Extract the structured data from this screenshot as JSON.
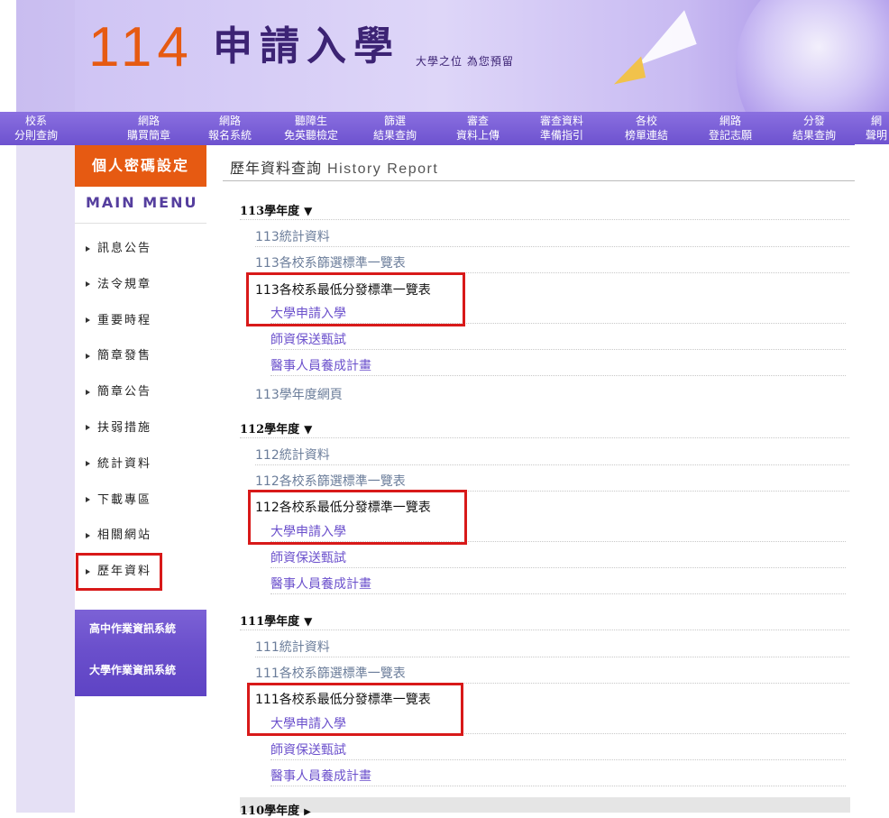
{
  "banner": {
    "number": "114",
    "title": "申請入學",
    "slogan": "大學之位 為您預留"
  },
  "topnav": [
    {
      "l1": "校系",
      "l2": "分則查詢"
    },
    {
      "l1": "網路",
      "l2": "購買簡章"
    },
    {
      "l1": "網路",
      "l2": "報名系統"
    },
    {
      "l1": "聽障生",
      "l2": "免英聽檢定"
    },
    {
      "l1": "篩選",
      "l2": "結果查詢"
    },
    {
      "l1": "審查",
      "l2": "資料上傳"
    },
    {
      "l1": "審查資料",
      "l2": "準備指引"
    },
    {
      "l1": "各校",
      "l2": "榜單連結"
    },
    {
      "l1": "網路",
      "l2": "登記志願"
    },
    {
      "l1": "分發",
      "l2": "結果查詢"
    },
    {
      "l1": "網",
      "l2": "聲明"
    }
  ],
  "sidebar": {
    "header": "個人密碼設定",
    "menu_title": "MAIN MENU",
    "items": [
      {
        "label": "訊息公告"
      },
      {
        "label": "法令規章"
      },
      {
        "label": "重要時程"
      },
      {
        "label": "簡章發售"
      },
      {
        "label": "簡章公告"
      },
      {
        "label": "扶弱措施"
      },
      {
        "label": "統計資料"
      },
      {
        "label": "下載專區"
      },
      {
        "label": "相關網站"
      },
      {
        "label": "歷年資料"
      }
    ],
    "systems": [
      {
        "label": "高中作業資訊系統"
      },
      {
        "label": "大學作業資訊系統"
      }
    ]
  },
  "main": {
    "title": "歷年資料查詢",
    "title_en": "History Report",
    "arrow_down": "▼",
    "arrow_right": "▶",
    "years": [
      {
        "label": "113學年度",
        "stats": "113統計資料",
        "screen": "113各校系篩選標準一覽表",
        "lowest": "113各校系最低分發標準一覽表",
        "sub1": "大學申請入學",
        "sub2": "師資保送甄試",
        "sub3": "醫事人員養成計畫",
        "web": "113學年度網頁"
      },
      {
        "label": "112學年度",
        "stats": "112統計資料",
        "screen": "112各校系篩選標準一覽表",
        "lowest": "112各校系最低分發標準一覽表",
        "sub1": "大學申請入學",
        "sub2": "師資保送甄試",
        "sub3": "醫事人員養成計畫"
      },
      {
        "label": "111學年度",
        "stats": "111統計資料",
        "screen": "111各校系篩選標準一覽表",
        "lowest": "111各校系最低分發標準一覽表",
        "sub1": "大學申請入學",
        "sub2": "師資保送甄試",
        "sub3": "醫事人員養成計畫"
      },
      {
        "label": "110學年度"
      }
    ]
  },
  "colors": {
    "accent_orange": "#e65a12",
    "nav_purple": "#6d52cf",
    "highlight_red": "#d81919"
  }
}
